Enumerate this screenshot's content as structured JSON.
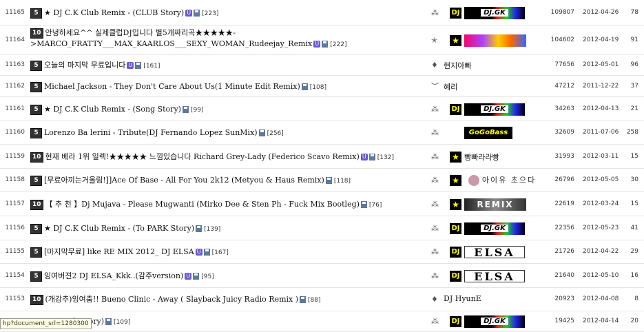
{
  "posts": [
    {
      "num": "11165",
      "lvl": "5",
      "title": "★ DJ C.K Club Remix - (CLUB Story)",
      "u": true,
      "d": true,
      "cnt": "[223]",
      "author": {
        "icon": "lv",
        "badge": "dj",
        "banner": "djgk",
        "banner_text": "DJ.GK",
        "text": ""
      },
      "hits": "109807",
      "date": "2012-04-26",
      "votes": "78"
    },
    {
      "num": "11164",
      "lvl": "10",
      "title": "안녕하세요^^ 실제클럽DJ입니다 별5개짜리곡★★★★★->MARCO_FRATTY___MAX_KAARLOS___SEXY_WOMAN_Rudeejay_Remix",
      "u": true,
      "d": true,
      "cnt": "[222]",
      "author": {
        "icon": "star",
        "badge": "star",
        "banner": "fire",
        "banner_text": "",
        "text": ""
      },
      "hits": "104602",
      "date": "2012-04-19",
      "votes": "91"
    },
    {
      "num": "11163",
      "lvl": "5",
      "title": "오늘의 마지막 무료입니다",
      "u": true,
      "d": true,
      "cnt": "[161]",
      "author": {
        "icon": "drop",
        "badge": "",
        "banner": "",
        "banner_text": "",
        "text": "현지아빠"
      },
      "hits": "77656",
      "date": "2012-05-01",
      "votes": "96"
    },
    {
      "num": "11162",
      "lvl": "5",
      "title": "Michael Jackson - They Don't Care About Us(1 Minute Edit Remix)",
      "u": false,
      "d": true,
      "cnt": "[108]",
      "author": {
        "icon": "wing",
        "badge": "",
        "banner": "",
        "banner_text": "",
        "text": "혜리"
      },
      "hits": "47212",
      "date": "2011-12-22",
      "votes": "37"
    },
    {
      "num": "11161",
      "lvl": "5",
      "title": "★ DJ C.K Club Remix - (Song Story)",
      "u": false,
      "d": true,
      "cnt": "[99]",
      "author": {
        "icon": "lv",
        "badge": "dj",
        "banner": "djgk",
        "banner_text": "DJ.GK",
        "text": ""
      },
      "hits": "34263",
      "date": "2012-04-13",
      "votes": "21"
    },
    {
      "num": "11160",
      "lvl": "5",
      "title": "Lorenzo Ba lerini - Tribute(DJ Fernando Lopez SunMix)",
      "u": false,
      "d": true,
      "cnt": "[256]",
      "author": {
        "icon": "lv",
        "badge": "",
        "banner": "gogo",
        "banner_text": "GoGoBass",
        "text": ""
      },
      "hits": "32609",
      "date": "2011-07-06",
      "votes": "258"
    },
    {
      "num": "11159",
      "lvl": "10",
      "title": "현재 베라 1위 일렉!★★★★★ 느낌있습니다 Richard Grey-Lady (Federico Scavo Remix)",
      "u": true,
      "d": true,
      "cnt": "[132]",
      "author": {
        "icon": "lv",
        "badge": "star",
        "banner": "",
        "banner_text": "",
        "text": "빵빠라라빵"
      },
      "hits": "31993",
      "date": "2012-03-11",
      "votes": "15"
    },
    {
      "num": "11158",
      "lvl": "5",
      "title": "[무료아끼는거올림!]]Ace Of Base - All For You 2k12 (Metyou & Haus Remix)",
      "u": false,
      "d": true,
      "cnt": "[118]",
      "author": {
        "icon": "lv",
        "badge": "star",
        "banner": "iu",
        "banner_text": "아이유 초으다",
        "text": ""
      },
      "hits": "26796",
      "date": "2012-05-05",
      "votes": "30"
    },
    {
      "num": "11157",
      "lvl": "10",
      "title": "【 추 천 】Dj Mujava - Please Mugwanti (Mirko Dee & Sten Ph - Fuck Mix Bootleg)",
      "u": false,
      "d": true,
      "cnt": "[76]",
      "author": {
        "icon": "lv",
        "badge": "star",
        "banner": "remix",
        "banner_text": "REMIX",
        "text": ""
      },
      "hits": "22619",
      "date": "2012-03-24",
      "votes": "15"
    },
    {
      "num": "11156",
      "lvl": "5",
      "title": "★ DJ C.K Club Remix - (To PARK Story)",
      "u": false,
      "d": true,
      "cnt": "[139]",
      "author": {
        "icon": "lv",
        "badge": "dj",
        "banner": "djgk",
        "banner_text": "DJ.GK",
        "text": ""
      },
      "hits": "22356",
      "date": "2012-05-23",
      "votes": "41"
    },
    {
      "num": "11155",
      "lvl": "5",
      "title": "[마지막무료] like RE MIX 2012_ DJ ELSA",
      "u": true,
      "d": true,
      "cnt": "[167]",
      "author": {
        "icon": "lv",
        "badge": "dj",
        "banner": "elsa",
        "banner_text": "ELSA",
        "text": ""
      },
      "hits": "21726",
      "date": "2012-04-22",
      "votes": "29"
    },
    {
      "num": "11154",
      "lvl": "5",
      "title": "잉여버젼2 DJ ELSA_Kkk..(감주version)",
      "u": true,
      "d": true,
      "cnt": "[95]",
      "author": {
        "icon": "lv",
        "badge": "dj",
        "banner": "elsa",
        "banner_text": "ELSA",
        "text": ""
      },
      "hits": "21640",
      "date": "2012-05-10",
      "votes": "16"
    },
    {
      "num": "11153",
      "lvl": "10",
      "title": "(개강추)잉여춤!! Bueno Clinic - Away ( Slayback Juicy Radio Remix )",
      "u": false,
      "d": true,
      "cnt": "[88]",
      "author": {
        "icon": "drop",
        "badge": "",
        "banner": "",
        "banner_text": "",
        "text": "DJ HyunE"
      },
      "hits": "20923",
      "date": "2012-04-08",
      "votes": "8"
    },
    {
      "num": "",
      "lvl": "",
      "title": "emix - (Fuck Story)",
      "u": false,
      "d": true,
      "cnt": "[109]",
      "author": {
        "icon": "lv",
        "badge": "dj",
        "banner": "djgk",
        "banner_text": "DJ.GK",
        "text": ""
      },
      "hits": "19425",
      "date": "2012-04-14",
      "votes": "20"
    }
  ],
  "status_tooltip": "hp?document_srl=1280300",
  "level_glyphs": {
    "lv": "⁂",
    "star": "✭",
    "drop": "♦",
    "wing": "︶"
  },
  "badge_text": {
    "dj": "DJ",
    "star": "★"
  }
}
